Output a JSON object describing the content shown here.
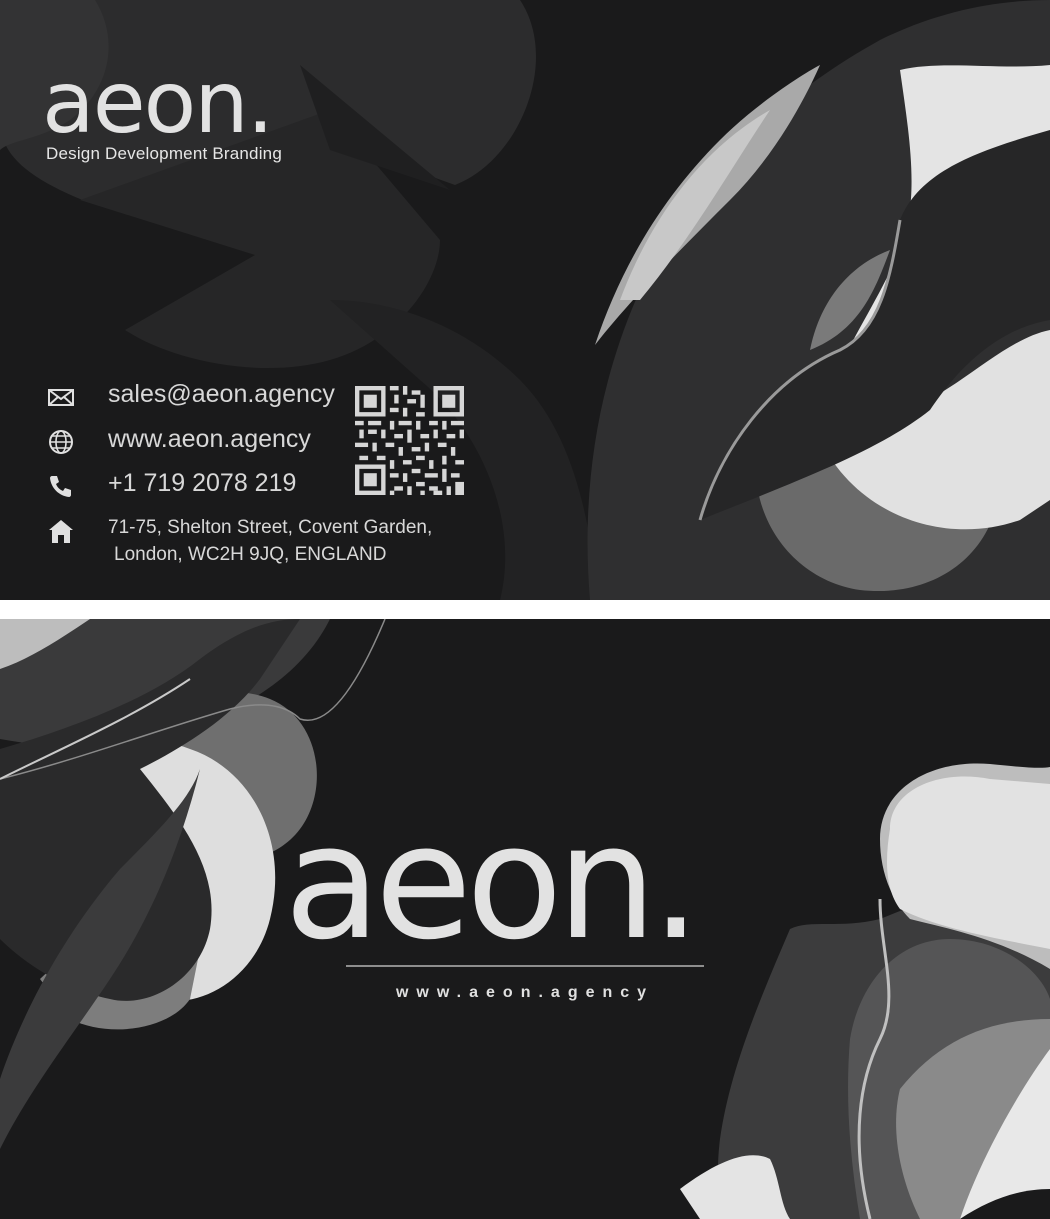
{
  "front": {
    "logo": "aeon.",
    "tagline": "Design Development Branding",
    "contacts": {
      "email": {
        "icon": "envelope-icon",
        "text": "sales@aeon.agency"
      },
      "website": {
        "icon": "globe-icon",
        "text": "www.aeon.agency"
      },
      "phone": {
        "icon": "phone-icon",
        "text": "+1 719 2078 219"
      },
      "address": {
        "icon": "home-icon",
        "line1": "71-75, Shelton Street, Covent Garden,",
        "line2": "London, WC2H 9JQ, ENGLAND"
      }
    },
    "qr_icon": "qr-code-icon"
  },
  "back": {
    "logo": "aeon.",
    "url": "www.aeon.agency"
  },
  "colors": {
    "background": "#1a1a1b",
    "text": "#e2e2e2",
    "shape_dark": "#2a2a2b",
    "shape_mid": "#444444",
    "shape_light": "#d9d9d9"
  }
}
